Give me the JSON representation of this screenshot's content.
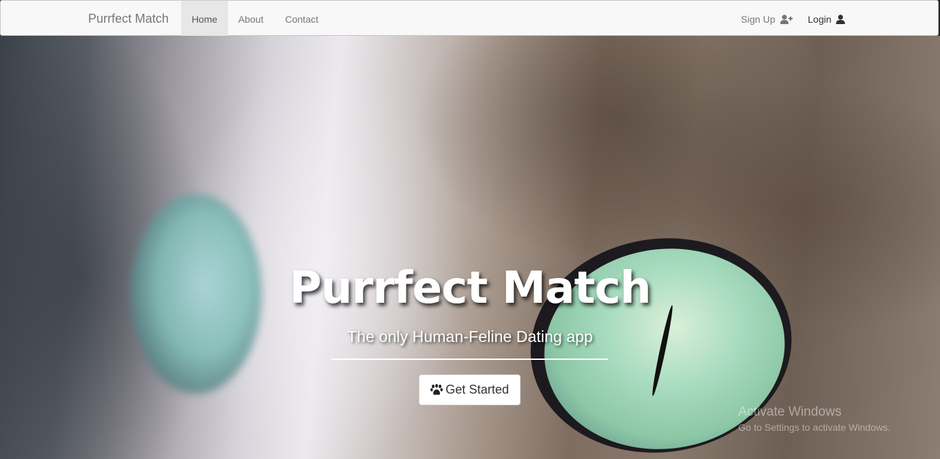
{
  "navbar": {
    "brand": "Purrfect Match",
    "links": [
      {
        "label": "Home",
        "active": true
      },
      {
        "label": "About"
      },
      {
        "label": "Contact"
      }
    ],
    "right": {
      "signup_label": "Sign Up",
      "signup_icon": "user-plus-icon",
      "login_label": "Login",
      "login_icon": "user-icon"
    }
  },
  "hero": {
    "title": "Purrfect Match",
    "subtitle": "The only Human-Feline Dating app",
    "cta_label": "Get Started",
    "cta_icon": "paw-icon"
  },
  "watermark": {
    "line1": "Activate Windows",
    "line2": "Go to Settings to activate Windows."
  },
  "colors": {
    "navbar_bg": "#f8f8f8",
    "active_tab_bg": "#e7e7e7",
    "text_muted": "#777777",
    "text_dark": "#333333"
  }
}
